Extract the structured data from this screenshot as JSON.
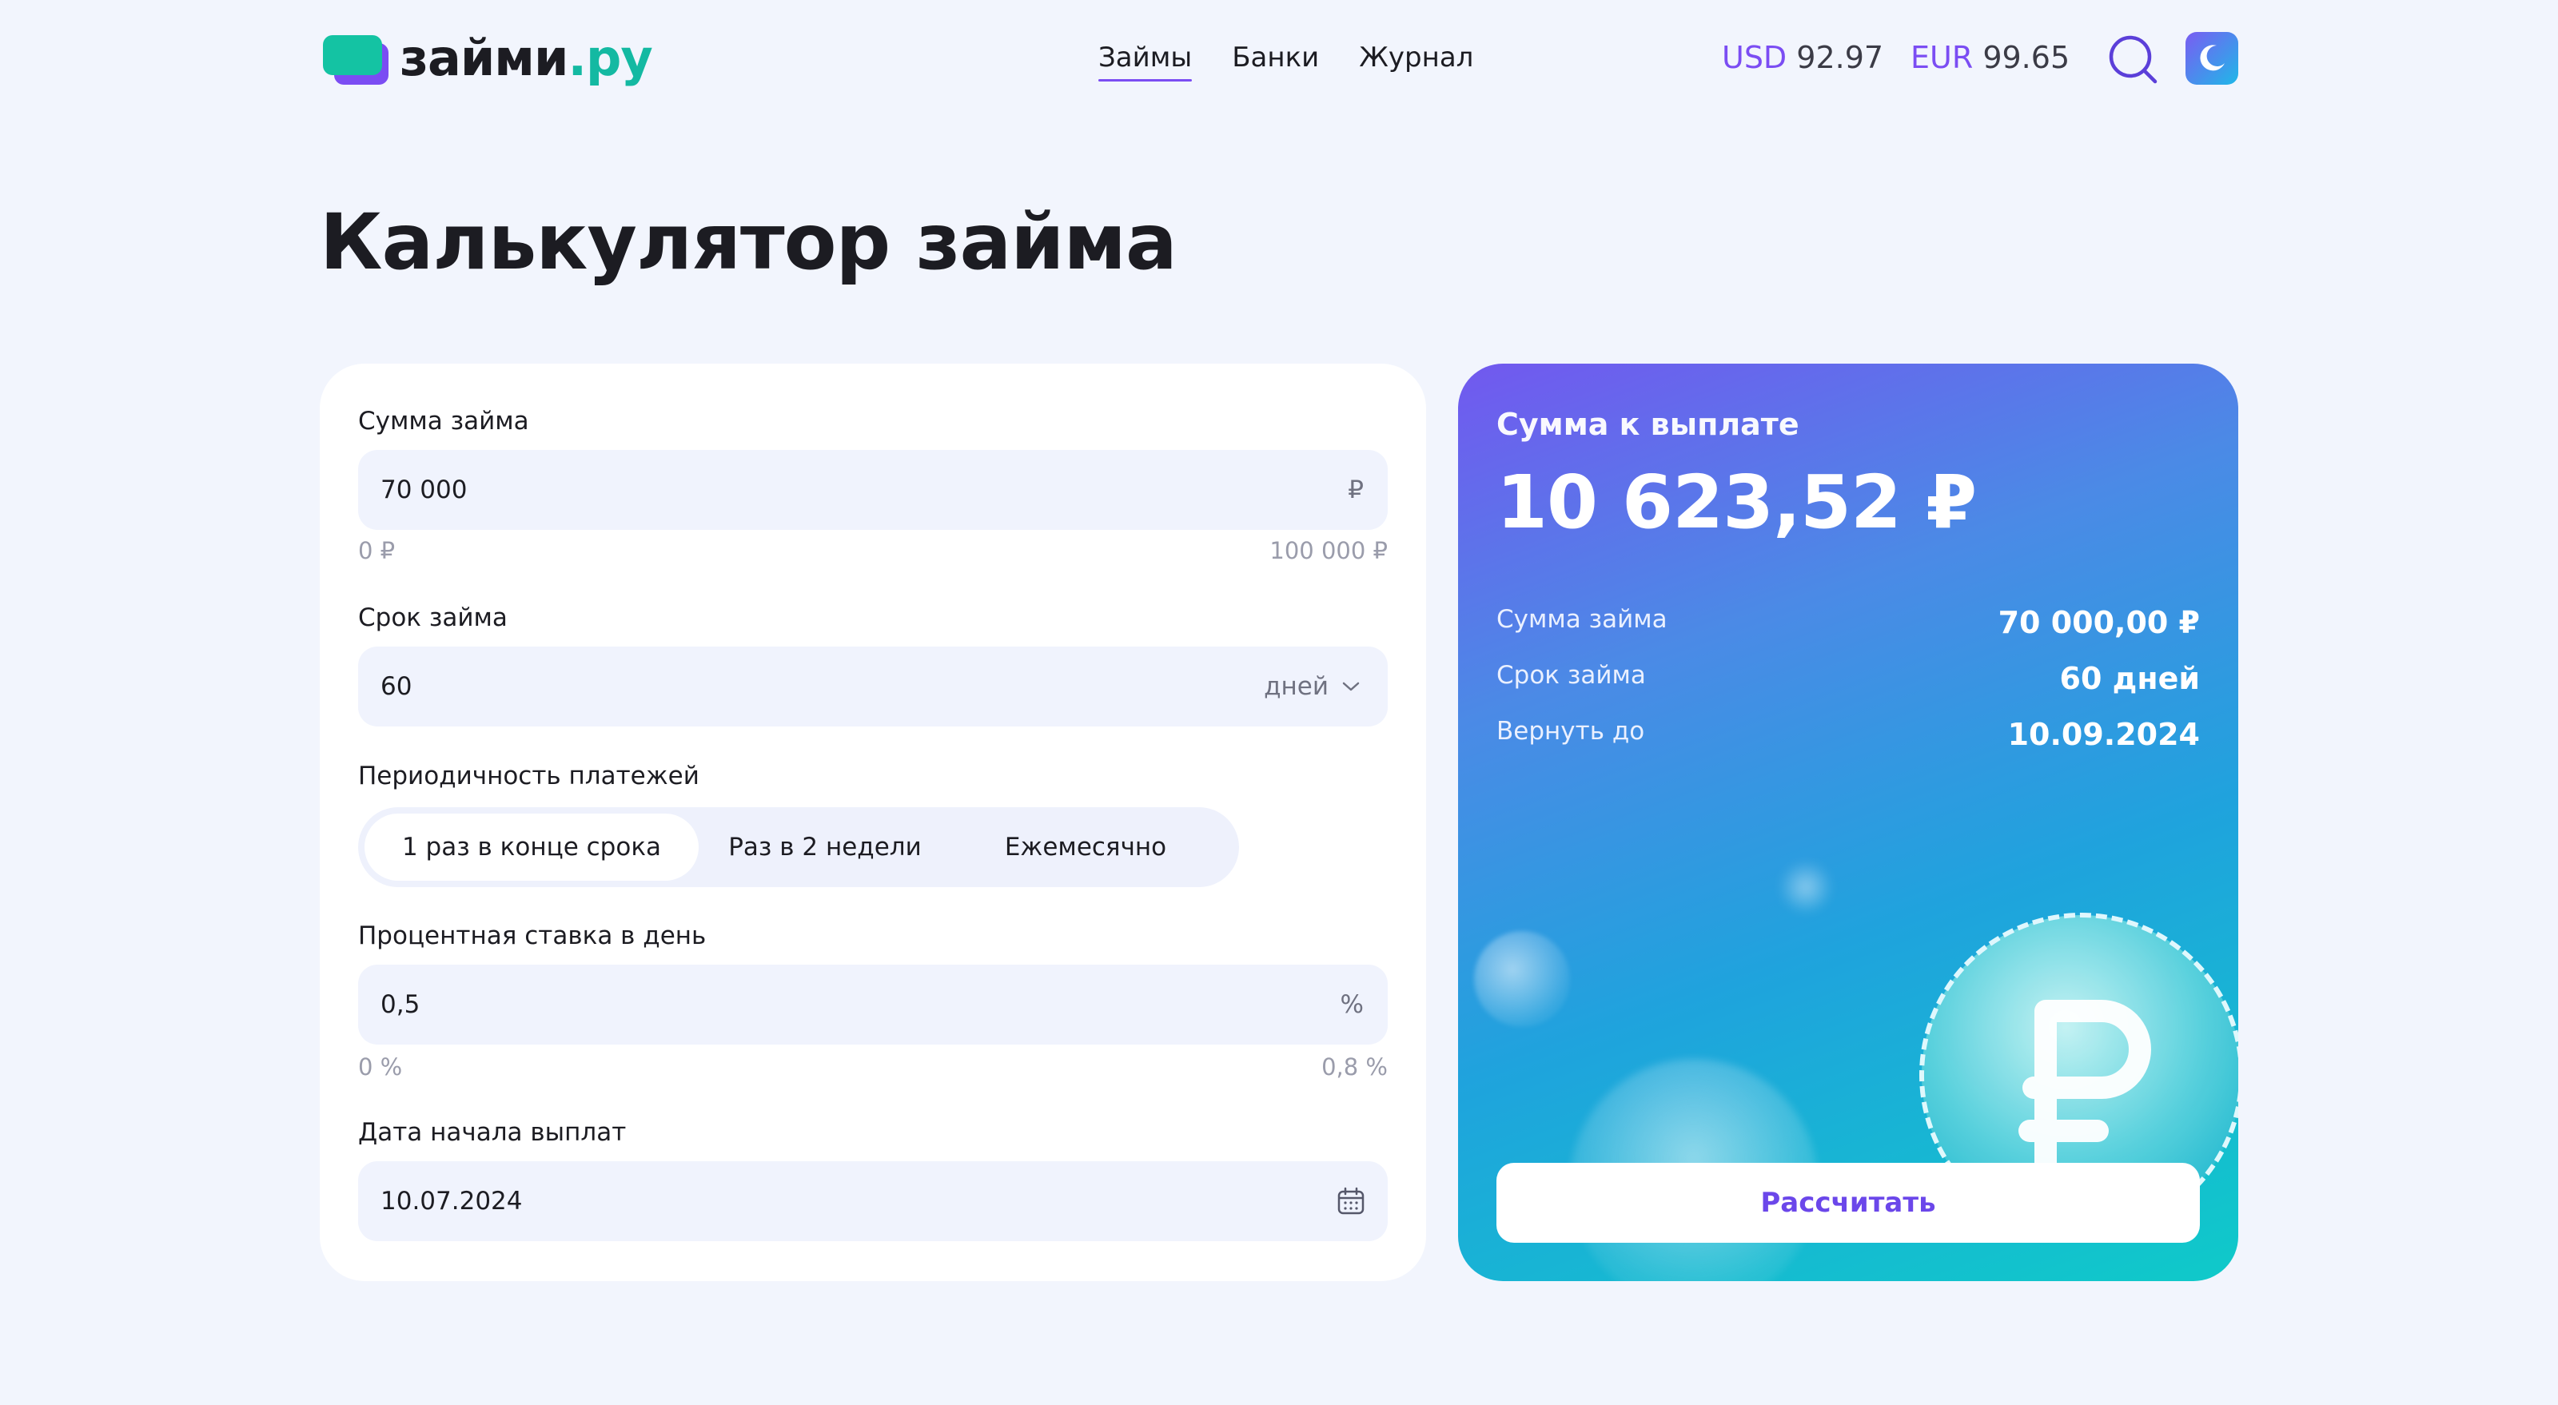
{
  "header": {
    "logo": {
      "part1": "займи",
      "part2": ".ру"
    },
    "nav": [
      {
        "label": "Займы",
        "active": true
      },
      {
        "label": "Банки",
        "active": false
      },
      {
        "label": "Журнал",
        "active": false
      }
    ],
    "rates": {
      "usd": {
        "currency": "USD",
        "value": "92.97"
      },
      "eur": {
        "currency": "EUR",
        "value": "99.65"
      }
    },
    "icons": {
      "search": "search-icon",
      "theme": "moon-icon"
    }
  },
  "page_title": "Калькулятор займа",
  "form": {
    "amount": {
      "label": "Сумма займа",
      "value": "70 000",
      "suffix": "₽",
      "min": "0 ₽",
      "max": "100 000 ₽"
    },
    "term": {
      "label": "Срок займа",
      "value": "60",
      "unit": "дней"
    },
    "frequency": {
      "label": "Периодичность платежей",
      "options": [
        "1 раз в конце срока",
        "Раз в 2 недели",
        "Ежемесячно"
      ],
      "selected": "1 раз в конце срока"
    },
    "rate": {
      "label": "Процентная ставка в день",
      "value": "0,5",
      "suffix": "%",
      "min": "0 %",
      "max": "0,8 %"
    },
    "start_date": {
      "label": "Дата начала выплат",
      "value": "10.07.2024"
    }
  },
  "result": {
    "title": "Сумма к выплате",
    "amount": "10 623,52 ₽",
    "rows": [
      {
        "label": "Сумма займа",
        "value": "70 000,00 ₽"
      },
      {
        "label": "Срок займа",
        "value": "60 дней"
      },
      {
        "label": "Вернуть до",
        "value": "10.09.2024"
      }
    ],
    "button_label": "Рассчитать"
  },
  "colors": {
    "accent": "#7b4df3",
    "logo_green": "#14c3a3",
    "background": "#f2f5fd",
    "input_bg": "#f0f3fd"
  }
}
